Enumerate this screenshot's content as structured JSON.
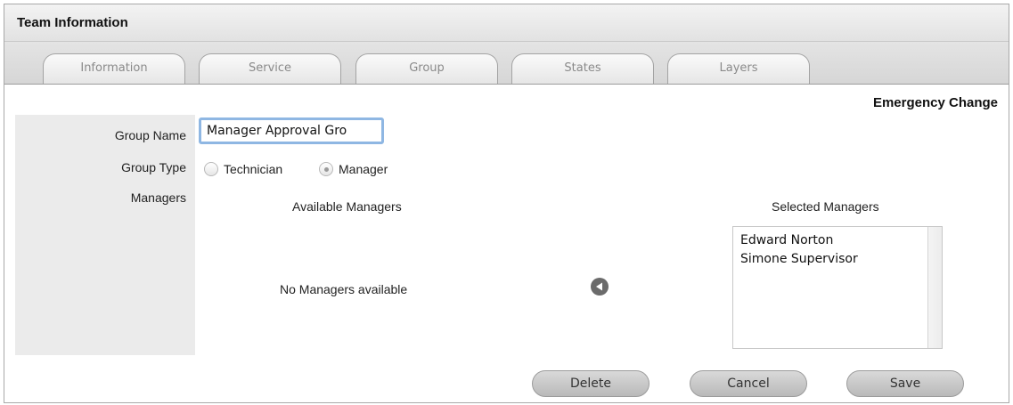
{
  "window": {
    "title": "Team Information"
  },
  "tabs": [
    {
      "label": "Information"
    },
    {
      "label": "Service"
    },
    {
      "label": "Group"
    },
    {
      "label": "States"
    },
    {
      "label": "Layers"
    }
  ],
  "form": {
    "section_title": "Emergency Change",
    "group_name_label": "Group Name",
    "group_name_value": "Manager Approval Gro",
    "group_type_label": "Group Type",
    "group_type_options": [
      {
        "label": "Technician",
        "checked": false
      },
      {
        "label": "Manager",
        "checked": true
      }
    ],
    "managers_label": "Managers",
    "available_header": "Available Managers",
    "available_empty": "No Managers available",
    "selected_header": "Selected Managers",
    "selected_items": [
      "Edward Norton",
      "Simone Supervisor"
    ]
  },
  "actions": {
    "delete_label": "Delete",
    "cancel_label": "Cancel",
    "save_label": "Save"
  },
  "icons": {
    "move_left": "arrow-left-icon"
  }
}
